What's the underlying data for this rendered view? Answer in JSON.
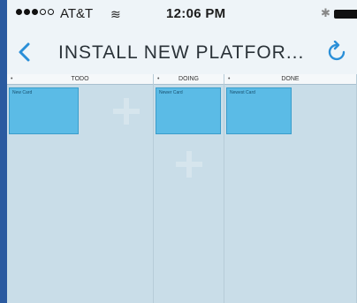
{
  "status_bar": {
    "carrier": "AT&T",
    "time": "12:06 PM"
  },
  "nav": {
    "title": "INSTALL NEW PLATFOR..."
  },
  "board": {
    "columns": [
      {
        "name": "TODO",
        "cards": [
          "New Card"
        ]
      },
      {
        "name": "DOING",
        "cards": [
          "Newer Card"
        ]
      },
      {
        "name": "DONE",
        "cards": [
          "Newest Card"
        ]
      }
    ]
  },
  "colors": {
    "accent": "#2a8fd8",
    "card": "#5bbbe6",
    "frame": "#2a5aa0"
  }
}
